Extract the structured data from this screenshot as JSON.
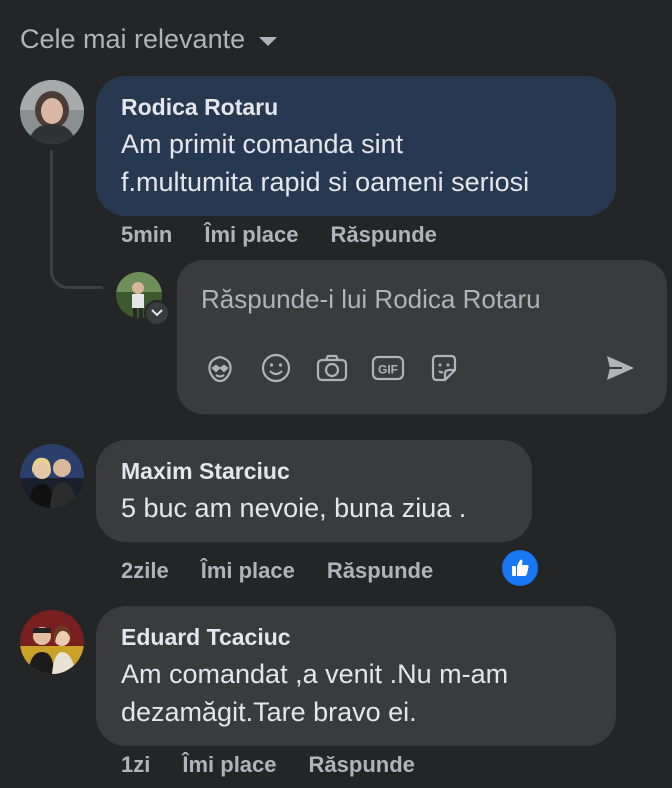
{
  "sort": {
    "label": "Cele mai relevante"
  },
  "comments": [
    {
      "author": "Rodica Rotaru",
      "text_lines": [
        "Am primit comanda sint",
        "f.multumita rapid si oameni seriosi"
      ],
      "time": "5min",
      "like_label": "Îmi place",
      "reply_label": "Răspunde",
      "bubble_color": "#263951"
    },
    {
      "author": "Maxim Starciuc",
      "text_lines": [
        "5 buc am nevoie, buna ziua ."
      ],
      "time": "2zile",
      "like_label": "Îmi place",
      "reply_label": "Răspunde",
      "reactions": [
        "like"
      ]
    },
    {
      "author": "Eduard Tcaciuc",
      "text_lines": [
        "Am comandat ,a venit .Nu m-am",
        "dezamăgit.Tare bravo ei."
      ],
      "time": "1zi",
      "like_label": "Îmi place",
      "reply_label": "Răspunde"
    }
  ],
  "reply": {
    "placeholder": "Răspunde-i lui Rodica Rotaru",
    "tools": [
      "avatar-sticker-icon",
      "emoji-icon",
      "camera-icon",
      "gif-icon",
      "sticker-icon",
      "send-icon"
    ]
  },
  "colors": {
    "background": "#242526",
    "bubble": "#3a3b3c",
    "highlight_bubble": "#263951",
    "secondary_text": "#b0b3b8",
    "primary_text": "#e4e6eb",
    "like_blue": "#1877f2"
  }
}
